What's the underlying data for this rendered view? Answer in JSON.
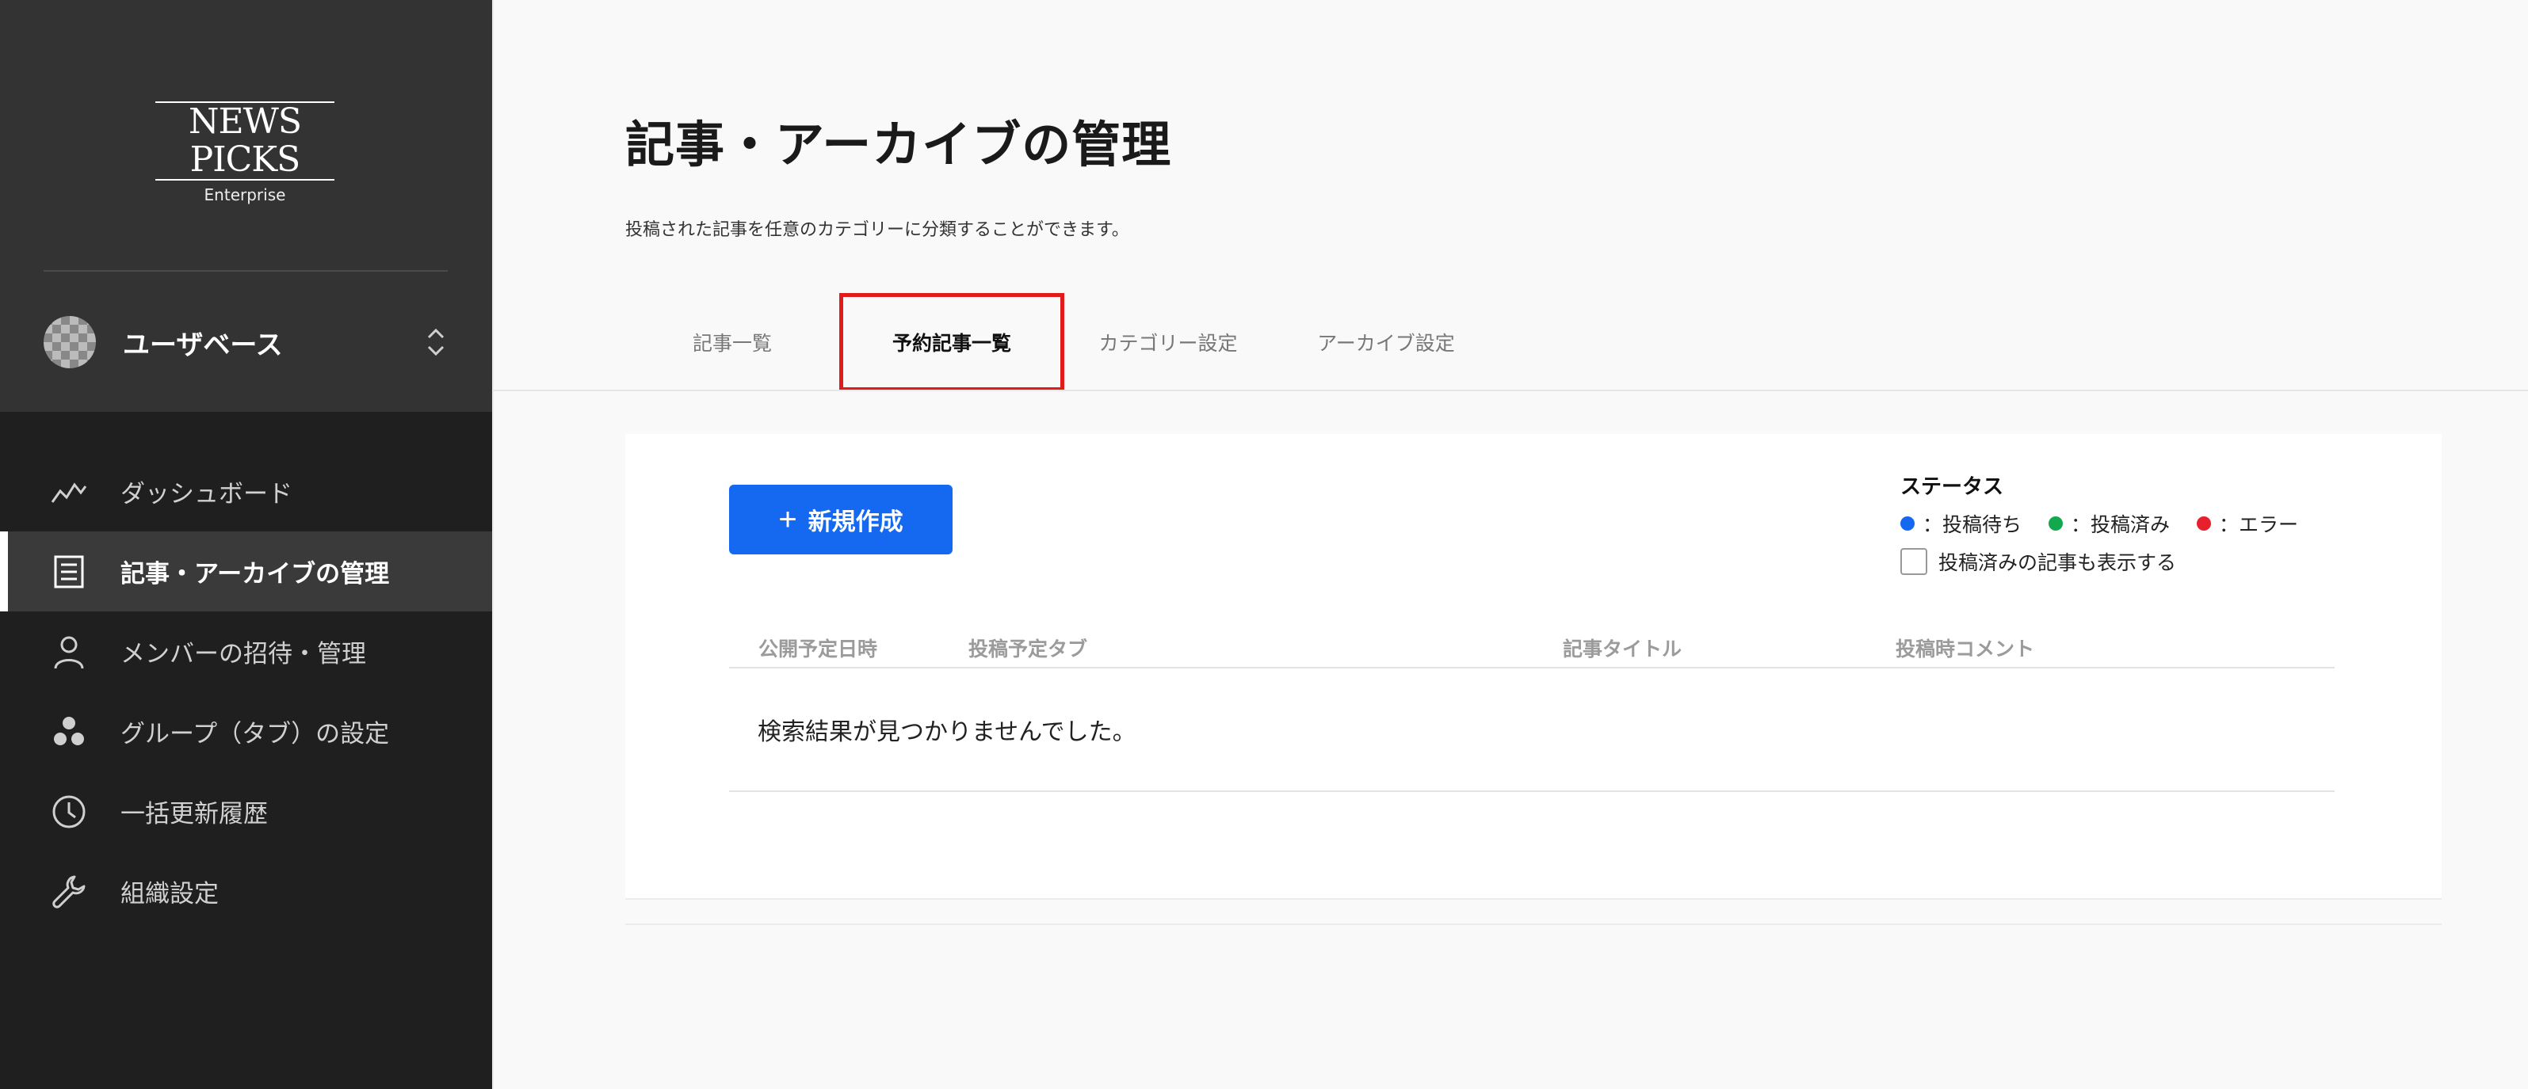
{
  "sidebar": {
    "logo": {
      "main": "NEWS PICKS",
      "sub": "Enterprise"
    },
    "org_name": "ユーザベース",
    "items": [
      {
        "label": "ダッシュボード",
        "icon": "chart-line-icon",
        "active": false
      },
      {
        "label": "記事・アーカイブの管理",
        "icon": "document-list-icon",
        "active": true
      },
      {
        "label": "メンバーの招待・管理",
        "icon": "person-icon",
        "active": false
      },
      {
        "label": "グループ（タブ）の設定",
        "icon": "group-dots-icon",
        "active": false
      },
      {
        "label": "一括更新履歴",
        "icon": "clock-icon",
        "active": false
      },
      {
        "label": "組織設定",
        "icon": "wrench-icon",
        "active": false
      }
    ]
  },
  "main": {
    "title": "記事・アーカイブの管理",
    "description": "投稿された記事を任意のカテゴリーに分類することができます。",
    "tabs": [
      {
        "label": "記事一覧",
        "active": false
      },
      {
        "label": "予約記事一覧",
        "active": true
      },
      {
        "label": "カテゴリー設定",
        "active": false
      },
      {
        "label": "アーカイブ設定",
        "active": false
      }
    ],
    "new_button": {
      "icon": "+",
      "label": "新規作成"
    },
    "status": {
      "title": "ステータス",
      "legend": [
        {
          "label": "：投稿待ち",
          "color": "#1569f0"
        },
        {
          "label": "：投稿済み",
          "color": "#12a84e"
        },
        {
          "label": "：エラー",
          "color": "#e8202e"
        }
      ],
      "checkbox_label": "投稿済みの記事も表示する",
      "checkbox_checked": false
    },
    "table": {
      "columns": [
        "公開予定日時",
        "投稿予定タブ",
        "記事タイトル",
        "投稿時コメント"
      ],
      "empty_message": "検索結果が見つかりませんでした。"
    }
  },
  "colors": {
    "accent": "#1569f0",
    "highlight_border": "#e21a1a",
    "sidebar_bg": "#1f1f1f"
  }
}
